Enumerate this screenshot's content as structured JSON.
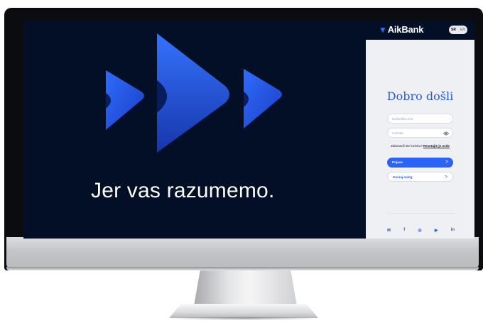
{
  "hero": {
    "title": "Jer vas razumemo."
  },
  "header": {
    "logo_text": "AikBank",
    "logo_mark": "▼",
    "lang_active": "SR",
    "lang_inactive": "EN"
  },
  "login": {
    "welcome": "Dobro došli",
    "username_placeholder": "Korisničko ime",
    "password_placeholder": "Lozinka",
    "forgot_text": "Zaboravili ste lozinku?",
    "reset_link": "Resetujte je ovde",
    "login_button": "Prijava",
    "create_button": "Kreiraj nalog"
  },
  "socials": [
    {
      "icon": "mail-icon",
      "glyph": "✉"
    },
    {
      "icon": "facebook-icon",
      "glyph": "f"
    },
    {
      "icon": "instagram-icon",
      "glyph": "◎"
    },
    {
      "icon": "youtube-icon",
      "glyph": "▶"
    },
    {
      "icon": "linkedin-icon",
      "glyph": "in"
    }
  ],
  "colors": {
    "screen_bg": "#020f26",
    "brand_blue": "#2a63f5",
    "panel_bg": "#eef0f4"
  }
}
